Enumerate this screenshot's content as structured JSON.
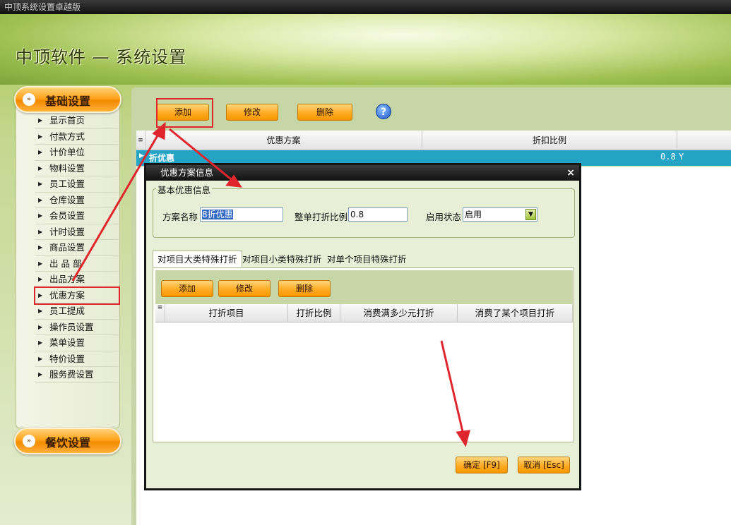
{
  "window": {
    "title": "中顶系统设置卓越版"
  },
  "app": {
    "title": "中顶软件 — 系统设置"
  },
  "sidebar": {
    "section1": "基础设置",
    "section2": "餐饮设置",
    "items": [
      "显示首页",
      "付款方式",
      "计价单位",
      "物料设置",
      "员工设置",
      "仓库设置",
      "会员设置",
      "计时设置",
      "商品设置",
      "出 品 部",
      "出品方案",
      "优惠方案",
      "员工提成",
      "操作员设置",
      "菜单设置",
      "特价设置",
      "服务费设置"
    ],
    "highlighted": "优惠方案"
  },
  "toolbar": {
    "add": "添加",
    "edit": "修改",
    "delete": "删除",
    "help_icon": "help-icon"
  },
  "grid": {
    "columns": [
      "优惠方案",
      "折扣比例"
    ],
    "rows": [
      {
        "name": "折优惠",
        "rate": "0.8",
        "extra": "Y"
      }
    ]
  },
  "dialog": {
    "title": "优惠方案信息",
    "close": "×",
    "group_title": "基本优惠信息",
    "name_label": "方案名称",
    "name_value": "8折优惠",
    "rate_label": "整单打折比例",
    "rate_value": "0.8",
    "status_label": "启用状态",
    "status_value": "启用",
    "tabs": [
      "对项目大类特殊打折",
      "对项目小类特殊打折",
      "对单个项目特殊打折"
    ],
    "inner_toolbar": {
      "add": "添加",
      "edit": "修改",
      "delete": "删除"
    },
    "inner_columns": [
      "打折项目",
      "打折比例",
      "消费满多少元打折",
      "消费了某个项目打折"
    ],
    "ok": "确定 [F9]",
    "cancel": "取消 [Esc]"
  },
  "colors": {
    "accent_orange": "#ffa31a",
    "highlight_red": "#e0262d",
    "row_selected": "#24a3c4"
  }
}
